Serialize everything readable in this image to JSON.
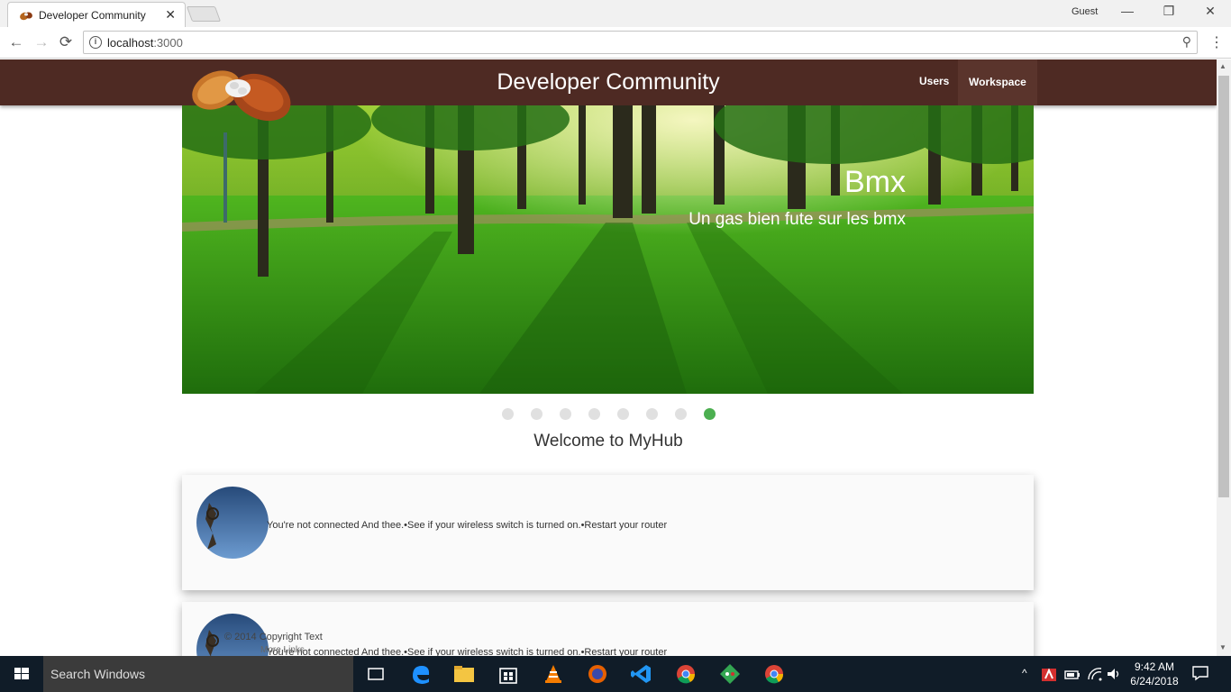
{
  "browser": {
    "tab_title": "Developer Community",
    "tab_close": "✕",
    "profile": "Guest",
    "minimize": "—",
    "restore": "❐",
    "close": "✕",
    "url_host": "localhost",
    "url_port": ":3000",
    "back": "←",
    "forward": "→",
    "reload": "⟳",
    "menu": "⋮",
    "zoom": "⚲"
  },
  "header": {
    "brand": "Developer Community",
    "nav": [
      {
        "label": "Users"
      },
      {
        "label": "Workspace"
      }
    ]
  },
  "carousel": {
    "title": "Bmx",
    "subtitle": "Un gas bien fute sur les bmx",
    "slide_count": 8,
    "active_index": 7
  },
  "welcome": "Welcome to MyHub",
  "cards": [
    {
      "message": "You're not connected And thee.•See if your wireless switch is turned on.•Restart your router"
    },
    {
      "message": "You're not connected And thee.•See if your wireless switch is turned on.•Restart your router"
    }
  ],
  "footer": {
    "copyright": "© 2014 Copyright Text",
    "links": "More Links"
  },
  "taskbar": {
    "search_placeholder": "Search Windows",
    "time": "9:42 AM",
    "date": "6/24/2018",
    "tray_up": "^"
  },
  "colors": {
    "appbar": "#4e2a23",
    "dot_active": "#4caf50",
    "taskbar": "#101c28"
  }
}
